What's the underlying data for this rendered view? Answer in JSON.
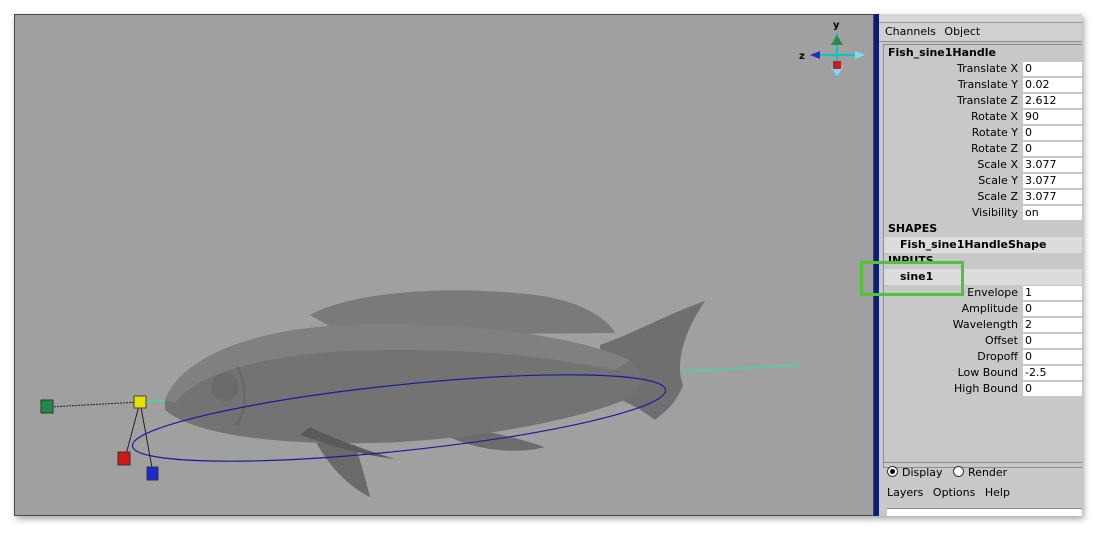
{
  "channel_box": {
    "menu": [
      "Channels",
      "Object"
    ],
    "node_name": "Fish_sine1Handle",
    "attributes": [
      {
        "label": "Translate X",
        "value": "0"
      },
      {
        "label": "Translate Y",
        "value": "0.02"
      },
      {
        "label": "Translate Z",
        "value": "2.612"
      },
      {
        "label": "Rotate X",
        "value": "90"
      },
      {
        "label": "Rotate Y",
        "value": "0"
      },
      {
        "label": "Rotate Z",
        "value": "0"
      },
      {
        "label": "Scale X",
        "value": "3.077"
      },
      {
        "label": "Scale Y",
        "value": "3.077"
      },
      {
        "label": "Scale Z",
        "value": "3.077"
      },
      {
        "label": "Visibility",
        "value": "on"
      }
    ],
    "shapes_header": "SHAPES",
    "shape_name": "Fish_sine1HandleShape",
    "inputs_header": "INPUTS",
    "input_name": "sine1",
    "input_attributes": [
      {
        "label": "Envelope",
        "value": "1"
      },
      {
        "label": "Amplitude",
        "value": "0"
      },
      {
        "label": "Wavelength",
        "value": "2"
      },
      {
        "label": "Offset",
        "value": "0"
      },
      {
        "label": "Dropoff",
        "value": "0"
      },
      {
        "label": "Low Bound",
        "value": "-2.5"
      },
      {
        "label": "High Bound",
        "value": "0"
      }
    ]
  },
  "layer_editor": {
    "display_label": "Display",
    "render_label": "Render",
    "selected": "Display",
    "menu": [
      "Layers",
      "Options",
      "Help"
    ]
  },
  "view_axis": {
    "y": "y",
    "z": "z"
  },
  "colors": {
    "viewport_bg": "#a0a0a0",
    "panel_bg": "#c8c8c8",
    "splitter": "#0b1f6e",
    "highlight": "#52c23a"
  }
}
